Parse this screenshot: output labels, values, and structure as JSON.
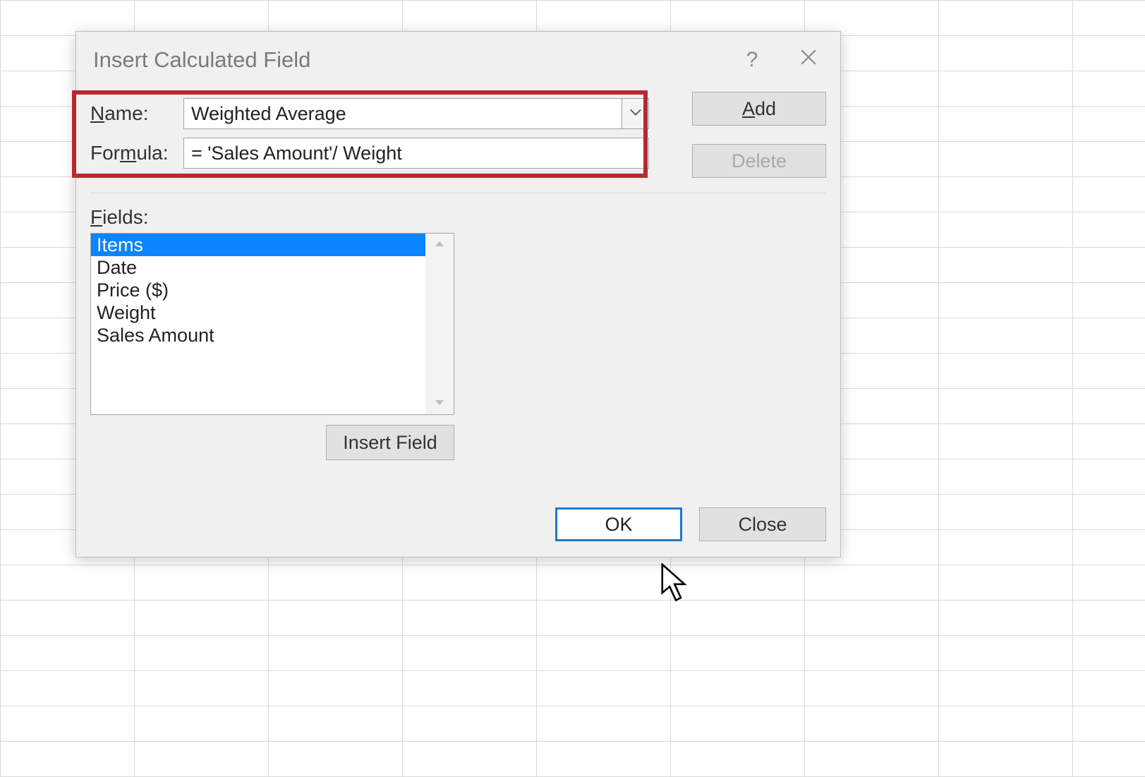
{
  "dialog": {
    "title": "Insert Calculated Field",
    "name_label_pre": "N",
    "name_label_post": "ame:",
    "name_value": "Weighted Average",
    "formula_label_pre": "For",
    "formula_label_mid": "m",
    "formula_label_post": "ula:",
    "formula_value": "= 'Sales Amount'/ Weight",
    "add_label_pre": "A",
    "add_label_post": "dd",
    "delete_label": "Delete",
    "fields_label_pre": "F",
    "fields_label_post": "ields:",
    "fields": [
      "Items",
      "Date",
      "Price ($)",
      "Weight",
      "Sales Amount"
    ],
    "selected_field_index": 0,
    "insert_field_label": "Insert Field",
    "ok_label": "OK",
    "close_label": "Close"
  }
}
